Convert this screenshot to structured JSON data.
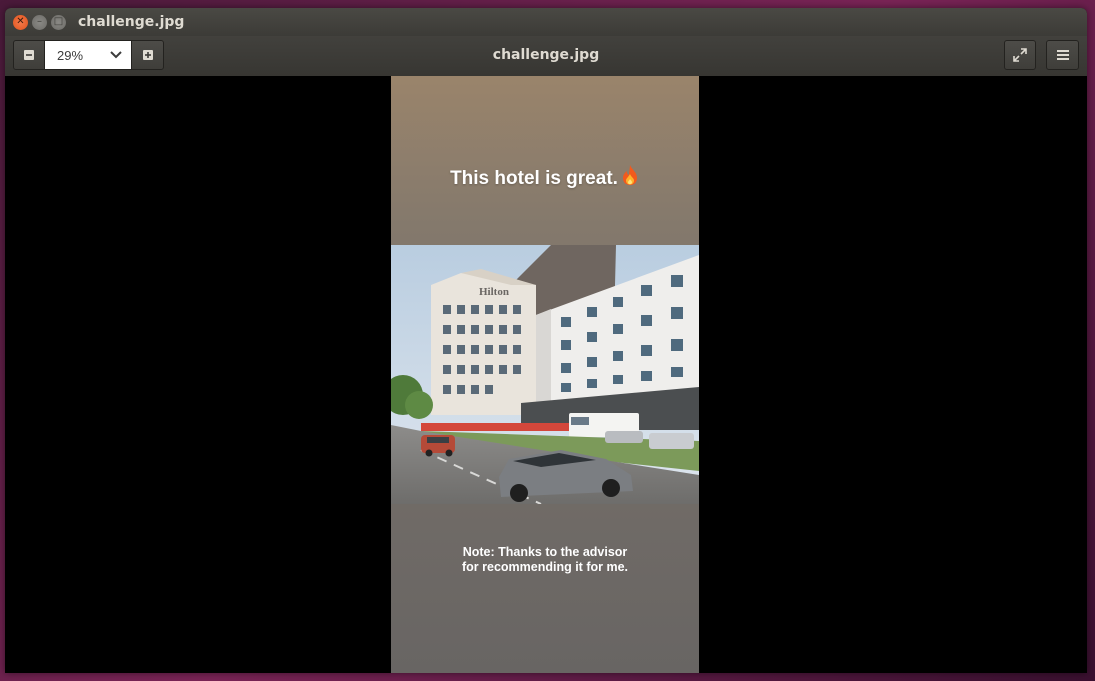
{
  "window": {
    "title": "challenge.jpg",
    "controls": {
      "close_icon": "close-icon",
      "minimize_icon": "minimize-icon",
      "maximize_icon": "maximize-icon"
    }
  },
  "toolbar": {
    "zoom_value": "29%",
    "zoom_out_icon": "minus-icon",
    "zoom_in_icon": "plus-icon",
    "dropdown_icon": "chevron-down-icon",
    "center_title": "challenge.jpg",
    "fullscreen_icon": "fullscreen-icon",
    "menu_icon": "hamburger-menu-icon"
  },
  "image": {
    "headline": "This hotel is great.",
    "headline_emoji": "fire-emoji",
    "photo_sign": "Hilton",
    "note_line1": "Note: Thanks to the advisor",
    "note_line2": "for recommending it for me."
  },
  "colors": {
    "close_button": "#e0531c",
    "titlebar": "#3c3b37",
    "background_top": "#9a846b",
    "background_bottom": "#686563"
  }
}
